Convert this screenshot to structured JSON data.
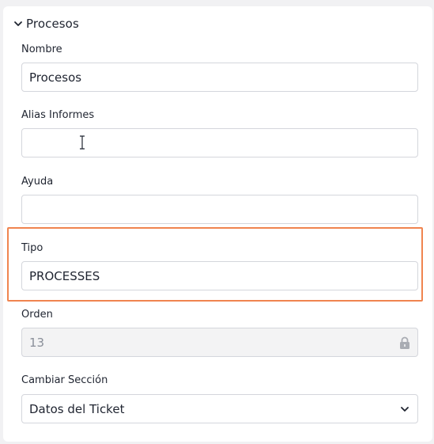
{
  "section": {
    "title": "Procesos",
    "collapse_icon": "chevron-down-icon"
  },
  "fields": {
    "nombre": {
      "label": "Nombre",
      "value": "Procesos"
    },
    "alias": {
      "label": "Alias Informes",
      "value": ""
    },
    "ayuda": {
      "label": "Ayuda",
      "value": ""
    },
    "tipo": {
      "label": "Tipo",
      "value": "PROCESSES"
    },
    "orden": {
      "label": "Orden",
      "value": "13",
      "icon": "lock-icon"
    },
    "seccion": {
      "label": "Cambiar Sección",
      "value": "Datos del Ticket",
      "icon": "chevron-down-icon"
    }
  },
  "colors": {
    "highlight": "#f0844f",
    "panel": "#ffffff",
    "background": "#f1f1f3"
  }
}
